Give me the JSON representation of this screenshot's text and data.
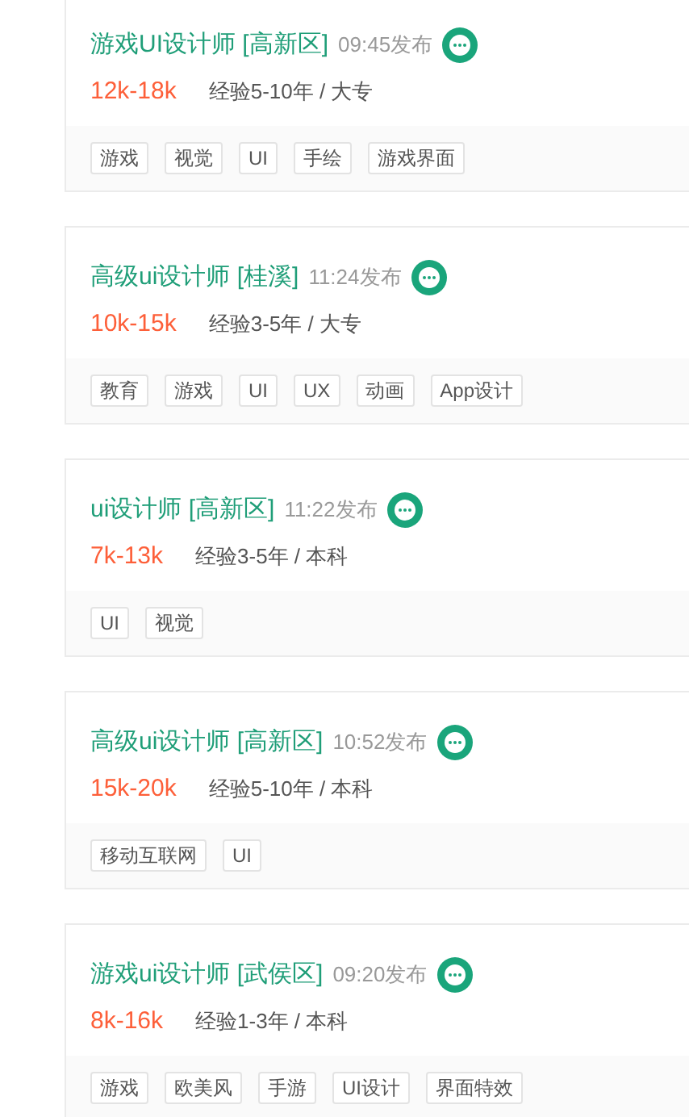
{
  "jobs": [
    {
      "title": "游戏UI设计师 [高新区]",
      "time": "09:45发布",
      "salary": "12k-18k",
      "requirements": "经验5-10年 / 大专",
      "tags": [
        "游戏",
        "视觉",
        "UI",
        "手绘",
        "游戏界面"
      ]
    },
    {
      "title": "高级ui设计师 [桂溪]",
      "time": "11:24发布",
      "salary": "10k-15k",
      "requirements": "经验3-5年 / 大专",
      "tags": [
        "教育",
        "游戏",
        "UI",
        "UX",
        "动画",
        "App设计"
      ]
    },
    {
      "title": "ui设计师 [高新区]",
      "time": "11:22发布",
      "salary": "7k-13k",
      "requirements": "经验3-5年 / 本科",
      "tags": [
        "UI",
        "视觉"
      ]
    },
    {
      "title": "高级ui设计师 [高新区]",
      "time": "10:52发布",
      "salary": "15k-20k",
      "requirements": "经验5-10年 / 本科",
      "tags": [
        "移动互联网",
        "UI"
      ]
    },
    {
      "title": "游戏ui设计师 [武侯区]",
      "time": "09:20发布",
      "salary": "8k-16k",
      "requirements": "经验1-3年 / 本科",
      "tags": [
        "游戏",
        "欧美风",
        "手游",
        "UI设计",
        "界面特效"
      ]
    }
  ]
}
